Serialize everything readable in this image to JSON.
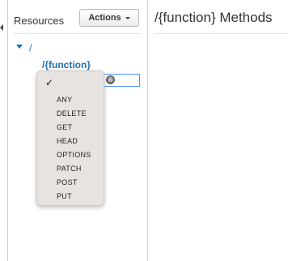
{
  "resources_panel": {
    "title": "Resources",
    "actions_button": {
      "label": "Actions",
      "icon": "caret-down-icon"
    }
  },
  "tree": {
    "root_label": "/",
    "child_label": "/{function}"
  },
  "method_select": {
    "cancel_icon": "⊗",
    "options_checked": "✓",
    "options": [
      "ANY",
      "DELETE",
      "GET",
      "HEAD",
      "OPTIONS",
      "PATCH",
      "POST",
      "PUT"
    ]
  },
  "details": {
    "title": "/{function} Methods"
  }
}
